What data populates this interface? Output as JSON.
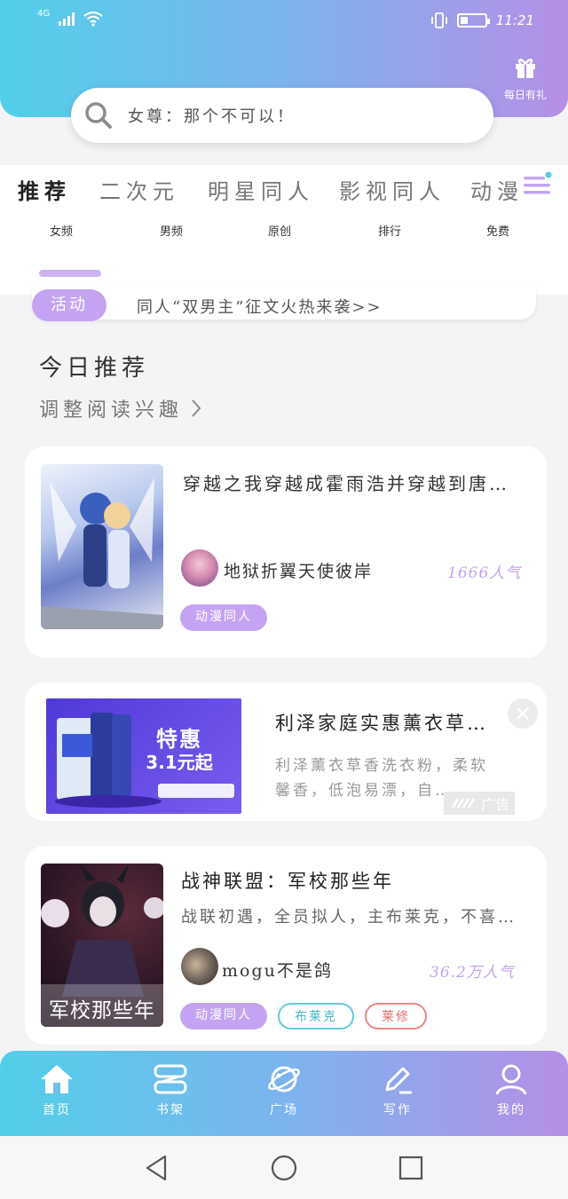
{
  "status_bar": {
    "network": "4G",
    "time": "11:21"
  },
  "header": {
    "search_placeholder": "女尊：那个不可以！",
    "gift_label": "每日有礼"
  },
  "tabs": [
    {
      "label": "推荐",
      "active": true
    },
    {
      "label": "二次元"
    },
    {
      "label": "明星同人"
    },
    {
      "label": "影视同人"
    },
    {
      "label": "动漫"
    }
  ],
  "sub_categories": [
    "女频",
    "男频",
    "原创",
    "排行",
    "免费"
  ],
  "notice": {
    "badge": "活动",
    "text": "同人“双男主”征文火热来袭>>"
  },
  "section": {
    "title": "今日推荐",
    "subtitle": "调整阅读兴趣"
  },
  "cards": [
    {
      "title": "穿越之我穿越成霍雨浩并穿越到唐…",
      "author": "地狱折翼天使彼岸",
      "popularity": "1666人气",
      "tags": [
        "动漫同人"
      ]
    },
    {
      "title": "战神联盟：军校那些年",
      "description": "战联初遇，全员拟人，主布莱克，不喜…",
      "author": "mogu不是鸽",
      "popularity": "36.2万人气",
      "cover_text": "军校那些年",
      "tags": [
        "动漫同人",
        "布莱克",
        "莱修"
      ]
    }
  ],
  "ad": {
    "title": "利泽家庭实惠薰衣草…",
    "description": "利泽薰衣草香洗衣粉，柔软馨香，低泡易漂，自…",
    "banner_headline": "特惠",
    "banner_price": "3.1元起",
    "ad_label": "广告"
  },
  "bottom_nav": [
    {
      "label": "首页",
      "icon": "home-icon"
    },
    {
      "label": "书架",
      "icon": "bookshelf-icon"
    },
    {
      "label": "广场",
      "icon": "planet-icon"
    },
    {
      "label": "写作",
      "icon": "pen-icon"
    },
    {
      "label": "我的",
      "icon": "user-icon"
    }
  ],
  "colors": {
    "gradient_start": "#52cfe9",
    "gradient_end": "#b58fe6",
    "accent": "#c4a4f2"
  }
}
